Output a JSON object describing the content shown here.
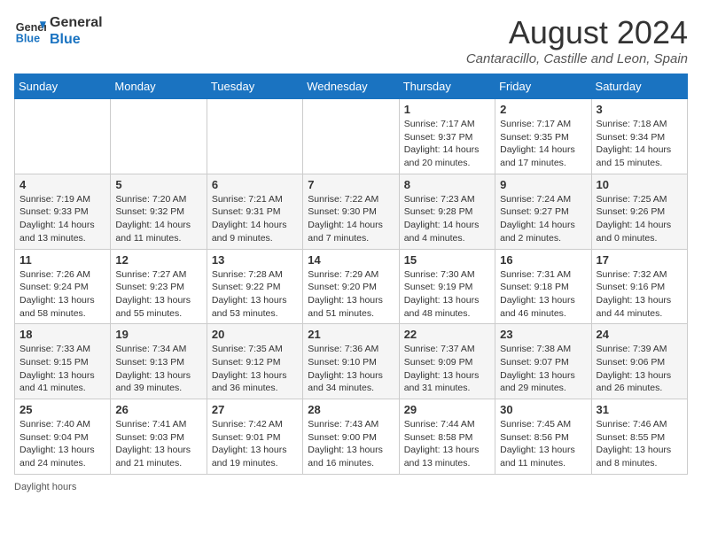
{
  "header": {
    "logo_line1": "General",
    "logo_line2": "Blue",
    "month_title": "August 2024",
    "subtitle": "Cantaracillo, Castille and Leon, Spain"
  },
  "days_of_week": [
    "Sunday",
    "Monday",
    "Tuesday",
    "Wednesday",
    "Thursday",
    "Friday",
    "Saturday"
  ],
  "weeks": [
    [
      {
        "day": "",
        "info": ""
      },
      {
        "day": "",
        "info": ""
      },
      {
        "day": "",
        "info": ""
      },
      {
        "day": "",
        "info": ""
      },
      {
        "day": "1",
        "info": "Sunrise: 7:17 AM\nSunset: 9:37 PM\nDaylight: 14 hours and 20 minutes."
      },
      {
        "day": "2",
        "info": "Sunrise: 7:17 AM\nSunset: 9:35 PM\nDaylight: 14 hours and 17 minutes."
      },
      {
        "day": "3",
        "info": "Sunrise: 7:18 AM\nSunset: 9:34 PM\nDaylight: 14 hours and 15 minutes."
      }
    ],
    [
      {
        "day": "4",
        "info": "Sunrise: 7:19 AM\nSunset: 9:33 PM\nDaylight: 14 hours and 13 minutes."
      },
      {
        "day": "5",
        "info": "Sunrise: 7:20 AM\nSunset: 9:32 PM\nDaylight: 14 hours and 11 minutes."
      },
      {
        "day": "6",
        "info": "Sunrise: 7:21 AM\nSunset: 9:31 PM\nDaylight: 14 hours and 9 minutes."
      },
      {
        "day": "7",
        "info": "Sunrise: 7:22 AM\nSunset: 9:30 PM\nDaylight: 14 hours and 7 minutes."
      },
      {
        "day": "8",
        "info": "Sunrise: 7:23 AM\nSunset: 9:28 PM\nDaylight: 14 hours and 4 minutes."
      },
      {
        "day": "9",
        "info": "Sunrise: 7:24 AM\nSunset: 9:27 PM\nDaylight: 14 hours and 2 minutes."
      },
      {
        "day": "10",
        "info": "Sunrise: 7:25 AM\nSunset: 9:26 PM\nDaylight: 14 hours and 0 minutes."
      }
    ],
    [
      {
        "day": "11",
        "info": "Sunrise: 7:26 AM\nSunset: 9:24 PM\nDaylight: 13 hours and 58 minutes."
      },
      {
        "day": "12",
        "info": "Sunrise: 7:27 AM\nSunset: 9:23 PM\nDaylight: 13 hours and 55 minutes."
      },
      {
        "day": "13",
        "info": "Sunrise: 7:28 AM\nSunset: 9:22 PM\nDaylight: 13 hours and 53 minutes."
      },
      {
        "day": "14",
        "info": "Sunrise: 7:29 AM\nSunset: 9:20 PM\nDaylight: 13 hours and 51 minutes."
      },
      {
        "day": "15",
        "info": "Sunrise: 7:30 AM\nSunset: 9:19 PM\nDaylight: 13 hours and 48 minutes."
      },
      {
        "day": "16",
        "info": "Sunrise: 7:31 AM\nSunset: 9:18 PM\nDaylight: 13 hours and 46 minutes."
      },
      {
        "day": "17",
        "info": "Sunrise: 7:32 AM\nSunset: 9:16 PM\nDaylight: 13 hours and 44 minutes."
      }
    ],
    [
      {
        "day": "18",
        "info": "Sunrise: 7:33 AM\nSunset: 9:15 PM\nDaylight: 13 hours and 41 minutes."
      },
      {
        "day": "19",
        "info": "Sunrise: 7:34 AM\nSunset: 9:13 PM\nDaylight: 13 hours and 39 minutes."
      },
      {
        "day": "20",
        "info": "Sunrise: 7:35 AM\nSunset: 9:12 PM\nDaylight: 13 hours and 36 minutes."
      },
      {
        "day": "21",
        "info": "Sunrise: 7:36 AM\nSunset: 9:10 PM\nDaylight: 13 hours and 34 minutes."
      },
      {
        "day": "22",
        "info": "Sunrise: 7:37 AM\nSunset: 9:09 PM\nDaylight: 13 hours and 31 minutes."
      },
      {
        "day": "23",
        "info": "Sunrise: 7:38 AM\nSunset: 9:07 PM\nDaylight: 13 hours and 29 minutes."
      },
      {
        "day": "24",
        "info": "Sunrise: 7:39 AM\nSunset: 9:06 PM\nDaylight: 13 hours and 26 minutes."
      }
    ],
    [
      {
        "day": "25",
        "info": "Sunrise: 7:40 AM\nSunset: 9:04 PM\nDaylight: 13 hours and 24 minutes."
      },
      {
        "day": "26",
        "info": "Sunrise: 7:41 AM\nSunset: 9:03 PM\nDaylight: 13 hours and 21 minutes."
      },
      {
        "day": "27",
        "info": "Sunrise: 7:42 AM\nSunset: 9:01 PM\nDaylight: 13 hours and 19 minutes."
      },
      {
        "day": "28",
        "info": "Sunrise: 7:43 AM\nSunset: 9:00 PM\nDaylight: 13 hours and 16 minutes."
      },
      {
        "day": "29",
        "info": "Sunrise: 7:44 AM\nSunset: 8:58 PM\nDaylight: 13 hours and 13 minutes."
      },
      {
        "day": "30",
        "info": "Sunrise: 7:45 AM\nSunset: 8:56 PM\nDaylight: 13 hours and 11 minutes."
      },
      {
        "day": "31",
        "info": "Sunrise: 7:46 AM\nSunset: 8:55 PM\nDaylight: 13 hours and 8 minutes."
      }
    ]
  ],
  "footer": {
    "daylight_label": "Daylight hours"
  }
}
